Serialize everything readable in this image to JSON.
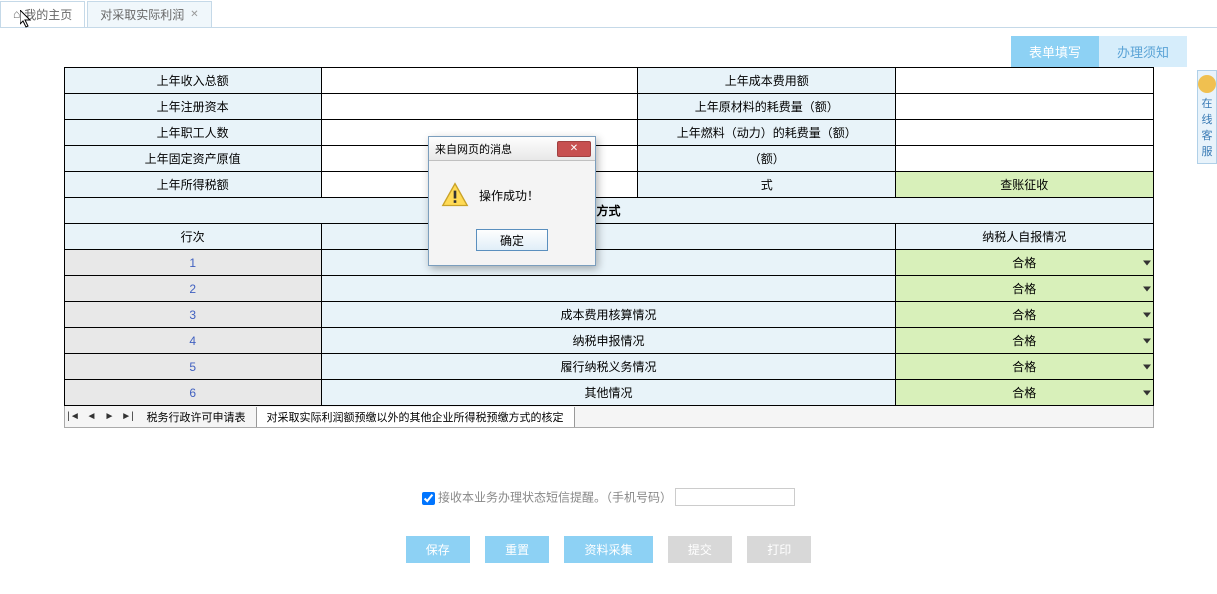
{
  "tabs": {
    "home": "我的主页",
    "current": "对采取实际利润"
  },
  "sub_tabs": {
    "form_fill": "表单填写",
    "notice": "办理须知"
  },
  "upper_rows": [
    {
      "label1": "上年收入总额",
      "label2": "上年成本费用额"
    },
    {
      "label1": "上年注册资本",
      "label2": "上年原材料的耗费量（额）"
    },
    {
      "label1": "上年职工人数",
      "label2": "上年燃料（动力）的耗费量（额）"
    },
    {
      "label1": "上年固定资产原值",
      "label2": "（额）"
    },
    {
      "label1": "上年所得税额",
      "label2": "式"
    }
  ],
  "collection_method": "查账征收",
  "section_header": "方式",
  "table_header": {
    "row": "行次",
    "item": "",
    "status": "纳税人自报情况"
  },
  "data_rows": [
    {
      "n": "1",
      "item": "",
      "status": "合格"
    },
    {
      "n": "2",
      "item": "",
      "status": "合格"
    },
    {
      "n": "3",
      "item": "成本费用核算情况",
      "status": "合格"
    },
    {
      "n": "4",
      "item": "纳税申报情况",
      "status": "合格"
    },
    {
      "n": "5",
      "item": "履行纳税义务情况",
      "status": "合格"
    },
    {
      "n": "6",
      "item": "其他情况",
      "status": "合格"
    }
  ],
  "sheet_tabs": {
    "prev": "税务行政许可申请表",
    "current": "对采取实际利润额预缴以外的其他企业所得税预缴方式的核定"
  },
  "sms": {
    "label": "接收本业务办理状态短信提醒。（手机号码）",
    "checked": true
  },
  "buttons": {
    "save": "保存",
    "reset": "重置",
    "collect": "资料采集",
    "submit": "提交",
    "print": "打印"
  },
  "dialog": {
    "title": "来自网页的消息",
    "message": "操作成功！",
    "ok": "确定"
  },
  "side_float": "在线客服"
}
